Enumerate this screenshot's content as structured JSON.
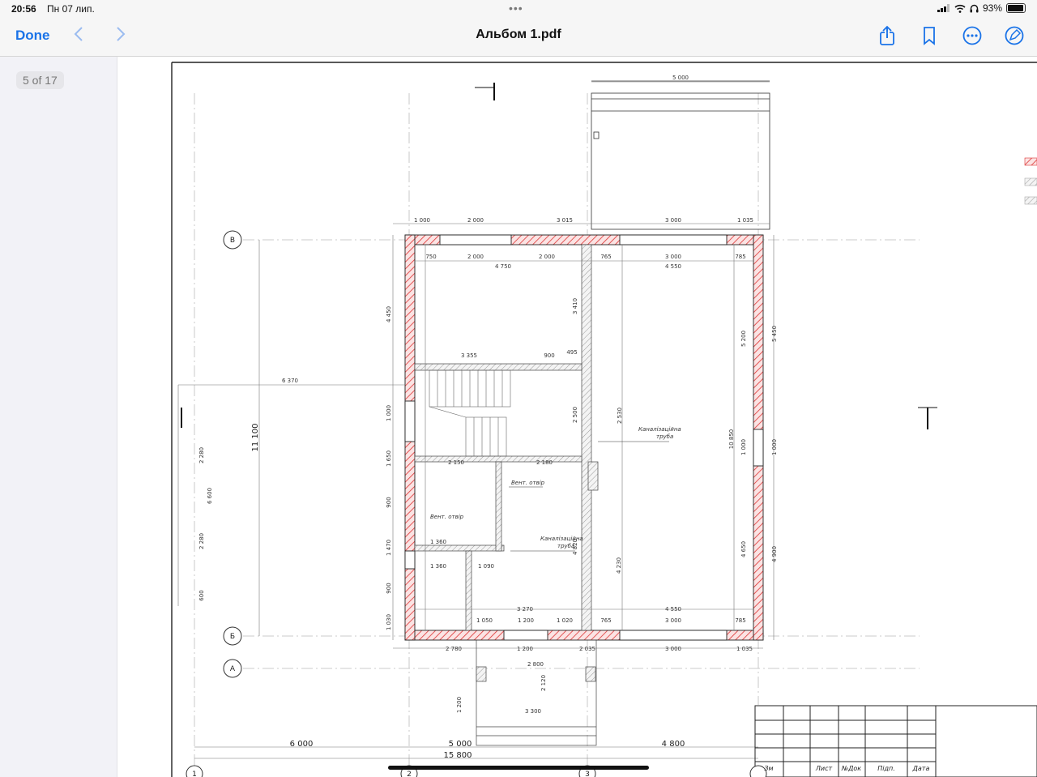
{
  "status_bar": {
    "time": "20:56",
    "date": "Пн 07 лип.",
    "battery": "93%"
  },
  "toolbar": {
    "done_label": "Done",
    "title": "Альбом 1.pdf",
    "icons": [
      "chevron-left-icon",
      "chevron-right-icon",
      "share-icon",
      "bookmark-icon",
      "more-icon",
      "markup-icon"
    ],
    "accent_color": "#1a73e8"
  },
  "sidebar": {
    "page_indicator": "5 of 17"
  },
  "drawing": {
    "axes": {
      "v": "В",
      "b": "Б",
      "a": "А",
      "n1": "1",
      "n2": "2",
      "n3": "3"
    },
    "total_height": "11 100",
    "bottom_dims": {
      "d1": "6 000",
      "d2": "5 000",
      "d3": "4 800",
      "total": "15 800"
    },
    "top_dims": {
      "t1": "1 000",
      "t2": "2 000",
      "t3": "3 015",
      "t4": "3 000",
      "t5": "1 035",
      "porch": "5 000"
    },
    "inner_top": {
      "i1": "750",
      "i2": "2 000",
      "i3": "2 000",
      "i4": "765",
      "i5": "3 000",
      "i6": "785",
      "r1": "4 750",
      "r2": "4 550"
    },
    "left_dims": {
      "l1": "4 450",
      "l2": "1 000",
      "l3": "1 650",
      "l4": "900",
      "l5": "1 470",
      "l6": "900",
      "l7": "1 030"
    },
    "right_dims": {
      "r1": "5 450",
      "r2": "1 000",
      "r3": "4 900",
      "h1": "5 200",
      "h2": "10 850",
      "h3": "1 000",
      "h4": "4 650"
    },
    "middle": {
      "stair": "3 355",
      "d900": "900",
      "d495": "495",
      "wall": "3 410",
      "wall2": "2 500",
      "h2530": "2 530",
      "d6370": "6 370"
    },
    "labels": {
      "sewer1a": "Каналізаційна",
      "sewer1b": "труба",
      "sewer2a": "Каналізаційна",
      "sewer2b": "труба",
      "vent1": "Вент. отвір",
      "vent2": "Вент. отвір"
    },
    "inner_dims": {
      "w2150": "2 150",
      "w2180": "2 180",
      "w1360a": "1 360",
      "w1360b": "1 360",
      "w1090": "1 090",
      "w3270": "3 270",
      "w4550b": "4 550",
      "w1050": "1 050",
      "w1200": "1 200",
      "w1020": "1 020",
      "w765b": "765",
      "w3000b": "3 000",
      "w785b": "785",
      "w4230": "4 230",
      "w4820": "4 820"
    },
    "bottom_inner": {
      "b1": "2 780",
      "b2": "1 200",
      "b3": "2 035",
      "b4": "3 000",
      "b5": "1 035"
    },
    "porch": {
      "p1": "2 800",
      "p2": "2 120",
      "p3": "3 300",
      "p4": "1 200"
    },
    "left_ext": {
      "e1": "2 280",
      "e2": "6 600",
      "e3": "2 280",
      "e4": "600"
    },
    "stamp_headers": {
      "c1": "Зм",
      "c2": "Лист",
      "c3": "№Док",
      "c4": "Підп.",
      "c5": "Дата"
    }
  }
}
